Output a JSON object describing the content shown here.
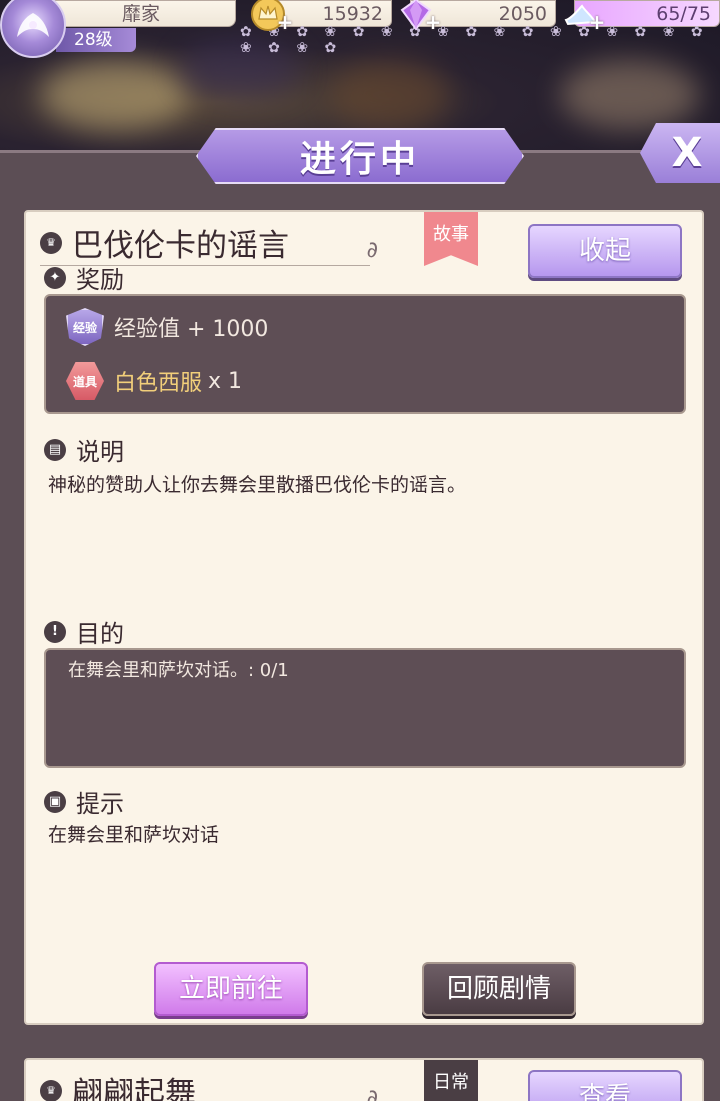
{
  "player": {
    "name": "靡家",
    "level": "28级"
  },
  "resources": {
    "gold": "15932",
    "gems": "2050",
    "energy": "65/75"
  },
  "header": {
    "title": "进行中",
    "close_label": "X"
  },
  "quest": {
    "title": "巴伐伦卡的谣言",
    "tag": "故事",
    "collapse_label": "收起",
    "reward_section": "奖励",
    "rewards": [
      {
        "badge": "经验",
        "text": "经验值 + 1000"
      },
      {
        "badge": "道具",
        "name": "白色西服",
        "count": "x 1"
      }
    ],
    "desc_section": "说明",
    "description": "神秘的赞助人让你去舞会里散播巴伐伦卡的谣言。",
    "goal_section": "目的",
    "goal": "在舞会里和萨坎对话。: 0/1",
    "hint_section": "提示",
    "hint": "在舞会里和萨坎对话",
    "go_label": "立即前往",
    "review_label": "回顾剧情"
  },
  "next_quest": {
    "title": "翩翩起舞",
    "tag": "日常",
    "view_label": "查看"
  },
  "colors": {
    "accent_purple": "#9a7fd8",
    "card_bg": "#fbf4e8",
    "dark_box": "#5e4e55",
    "reward_gold": "#f2cf7a",
    "go_button": "#d07bea"
  }
}
